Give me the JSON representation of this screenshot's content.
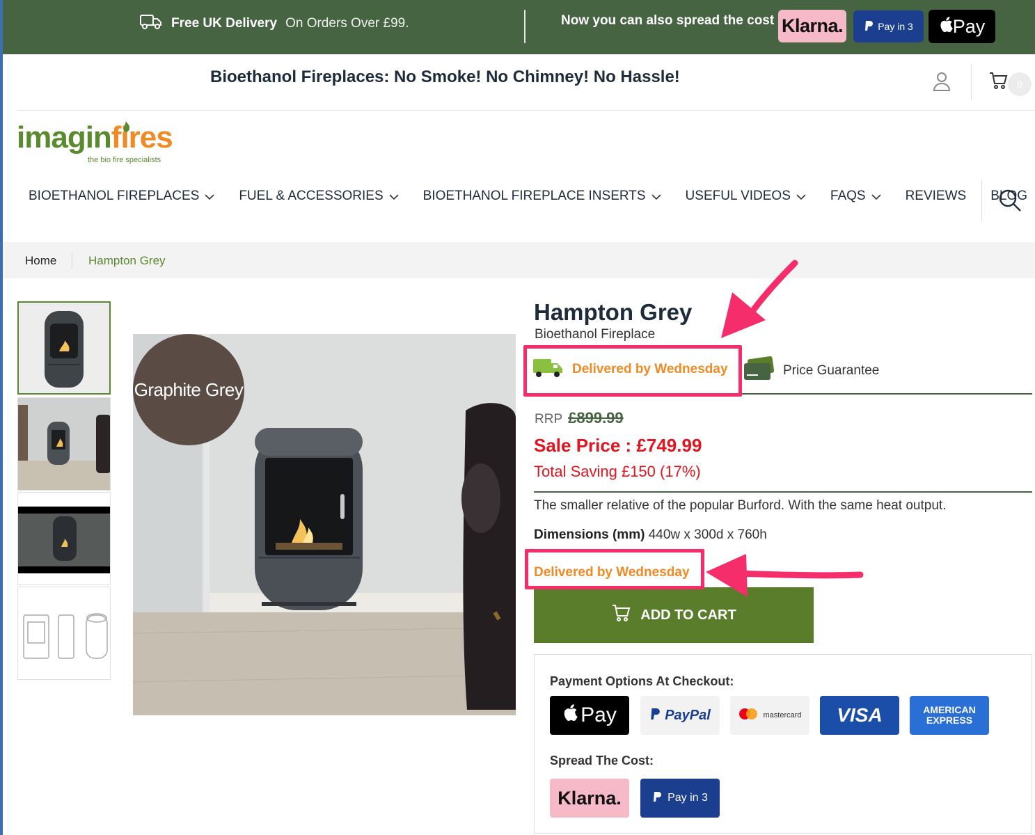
{
  "topbar": {
    "delivery_bold": "Free UK Delivery",
    "delivery_rest": "On Orders Over £99.",
    "spread_text": "Now you can also spread the cost",
    "klarna": "Klarna.",
    "payin3": "Pay in 3",
    "applepay": "Pay"
  },
  "header": {
    "tagline": "Bioethanol Fireplaces: No Smoke! No Chimney! No Hassle!",
    "cart_count": "0"
  },
  "logo": {
    "part1": "imagin",
    "part2": "fires",
    "sub": "the bio fire specialists"
  },
  "nav": {
    "items": [
      {
        "label": "BIOETHANOL FIREPLACES"
      },
      {
        "label": "FUEL & ACCESSORIES"
      },
      {
        "label": "BIOETHANOL FIREPLACE INSERTS"
      },
      {
        "label": "USEFUL VIDEOS"
      },
      {
        "label": "FAQS"
      },
      {
        "label": "REVIEWS"
      },
      {
        "label": "BLOG"
      }
    ]
  },
  "breadcrumb": {
    "home": "Home",
    "current": "Hampton Grey"
  },
  "product": {
    "badge": "Graphite Grey",
    "title": "Hampton Grey",
    "subtitle": "Bioethanol Fireplace",
    "delivery_tag": "Delivered by Wednesday",
    "price_guarantee": "Price Guarantee",
    "rrp_label": "RRP",
    "rrp_value": "£899.99",
    "sale_price": "Sale Price : £749.99",
    "saving": "Total Saving £150 (17%)",
    "description": "The smaller relative of the popular Burford. With the same heat output.",
    "dims_label": "Dimensions (mm)",
    "dims_value": "440w x 300d x 760h",
    "delivery_note": "Delivered by Wednesday",
    "add_to_cart": "ADD TO CART"
  },
  "payment": {
    "heading": "Payment Options At Checkout:",
    "apple": "Pay",
    "paypal": "PayPal",
    "mastercard": "mastercard",
    "visa": "VISA",
    "amex_line1": "AMERICAN",
    "amex_line2": "EXPRESS",
    "spread_heading": "Spread The Cost:",
    "klarna": "Klarna.",
    "payin3": "Pay in 3"
  },
  "colors": {
    "topbar": "#466342",
    "brand_green": "#5a8a2e",
    "brand_orange": "#f08a24",
    "sale_red": "#e3141f",
    "add_to_cart": "#5a7d2c",
    "highlight": "#f52d6b"
  }
}
